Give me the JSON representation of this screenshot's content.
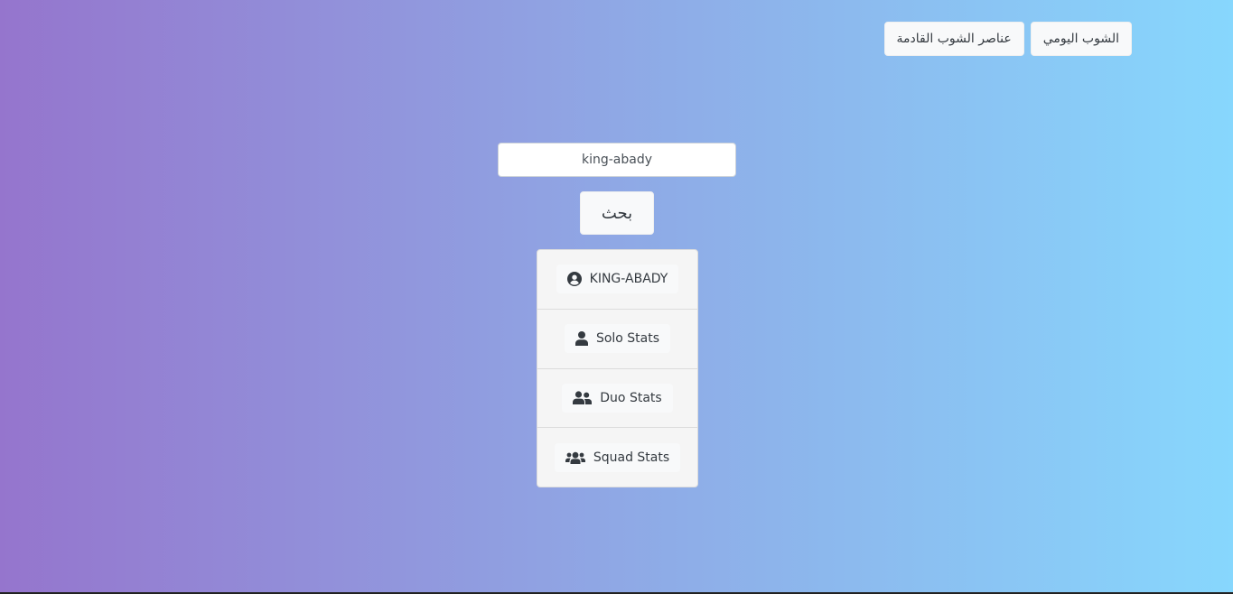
{
  "nav": {
    "daily_shop_label": "الشوب اليومي",
    "upcoming_items_label": "عناصر الشوب القادمة"
  },
  "search": {
    "value": "king-abady",
    "button_label": "بحث"
  },
  "results": {
    "player_name": "KING-ABADY",
    "solo_label": "Solo Stats",
    "duo_label": "Duo Stats",
    "squad_label": "Squad Stats"
  },
  "icons": {
    "player": "user-circle-icon",
    "solo": "user-icon",
    "duo": "user-friends-icon",
    "squad": "users-icon"
  },
  "colors": {
    "gradient_start": "#9575cd",
    "gradient_end": "#87d7fd",
    "button_bg": "#f8f9fa",
    "text": "#343a40"
  }
}
